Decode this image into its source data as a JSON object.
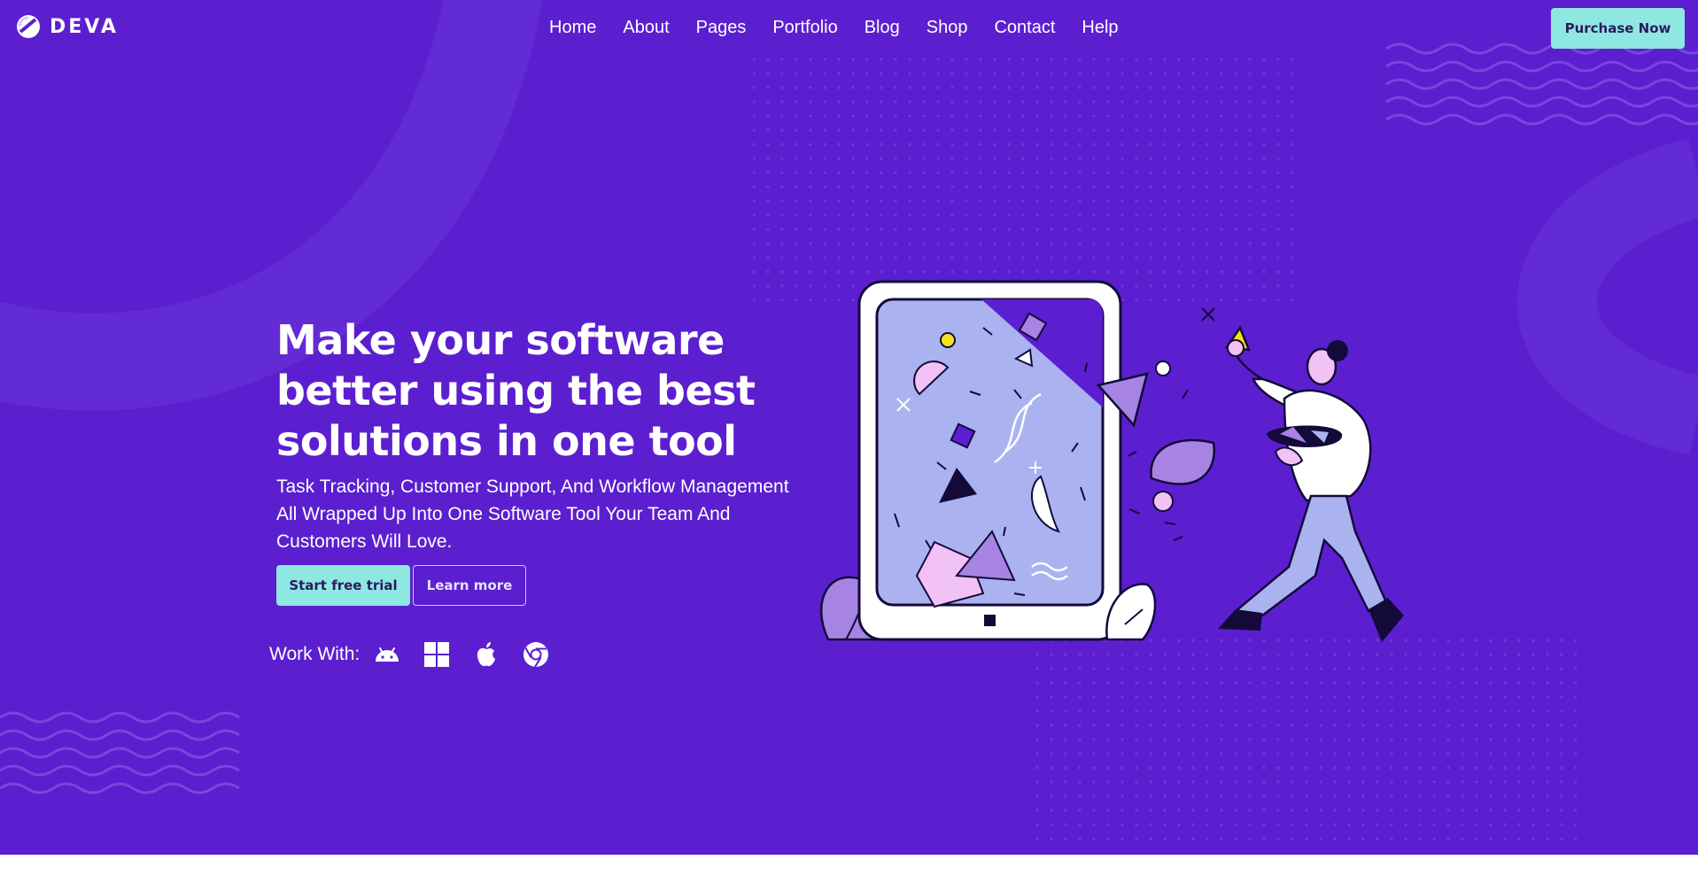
{
  "header": {
    "brand": "DEVA",
    "nav": [
      "Home",
      "About",
      "Pages",
      "Portfolio",
      "Blog",
      "Shop",
      "Contact",
      "Help"
    ],
    "cta_label": "Purchase Now"
  },
  "hero": {
    "headline": "Make your software better using the best solutions in one tool",
    "subtext": "Task Tracking, Customer Support, And Workflow Management All Wrapped Up Into One Software Tool Your Team And Customers Will Love.",
    "primary_button": "Start free trial",
    "secondary_button": "Learn more",
    "work_with_label": "Work With:",
    "platforms": [
      "android-icon",
      "windows-icon",
      "apple-icon",
      "chrome-icon"
    ]
  },
  "colors": {
    "background": "#5b1fd0",
    "accent": "#8ee8e1",
    "text": "#ffffff"
  }
}
